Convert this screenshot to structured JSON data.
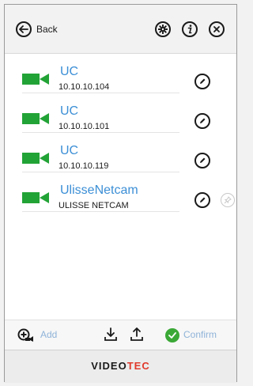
{
  "header": {
    "back_label": "Back"
  },
  "devices": [
    {
      "name": "UC",
      "address": "10.10.10.104",
      "pinned_icon": false
    },
    {
      "name": "UC",
      "address": "10.10.10.101",
      "pinned_icon": false
    },
    {
      "name": "UC",
      "address": "10.10.10.119",
      "pinned_icon": false
    },
    {
      "name": "UlisseNetcam",
      "address": "ULISSE NETCAM",
      "pinned_icon": true
    }
  ],
  "toolbar": {
    "add_label": "Add",
    "confirm_label": "Confirm"
  },
  "footer": {
    "logo_part1": "VIDEO",
    "logo_part2": "TEC"
  },
  "colors": {
    "accent_blue": "#3c8fd6",
    "camera_green": "#22a336",
    "confirm_green": "#3aa836",
    "logo_red": "#e03a2c"
  },
  "icons": {
    "back": "arrow-left-circle-icon",
    "settings": "gear-icon",
    "info": "info-icon",
    "close": "close-icon",
    "camera": "video-camera-icon",
    "edit": "pencil-icon",
    "pin": "pin-icon",
    "add": "add-plus-icon",
    "download": "download-icon",
    "upload": "upload-icon",
    "confirm": "checkmark-icon"
  }
}
